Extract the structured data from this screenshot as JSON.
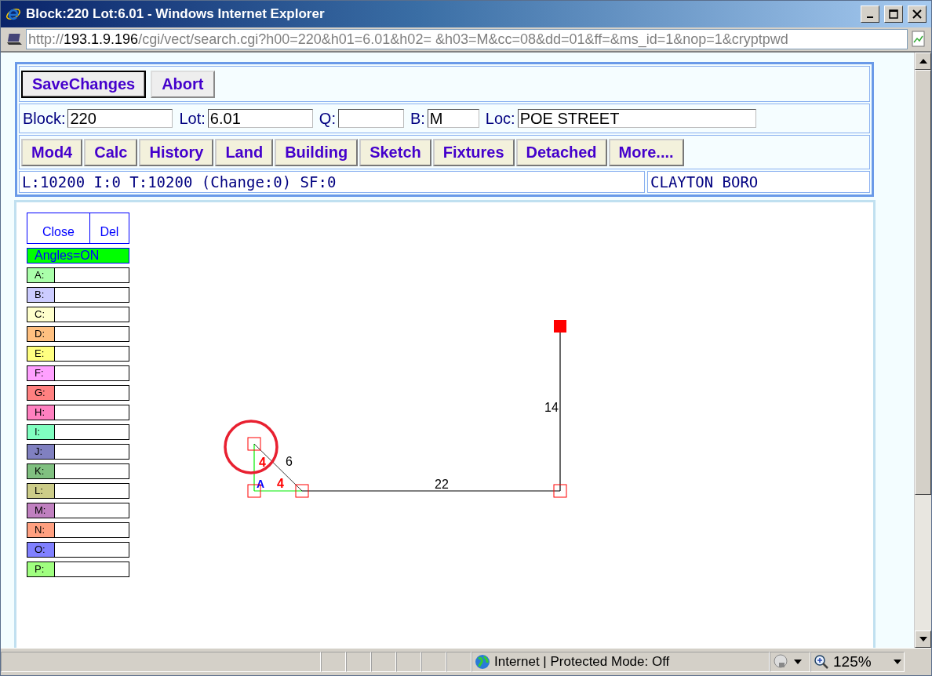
{
  "window": {
    "title": "Block:220 Lot:6.01 - Windows Internet Explorer"
  },
  "address": {
    "scheme": "http://",
    "host": "193.1.9.196",
    "path": "/cgi/vect/search.cgi?h00=220&h01=6.01&h02= &h03=M&cc=08&dd=01&ff=&ms_id=1&nop=1&cryptpwd"
  },
  "actions": [
    {
      "label": "SaveChanges",
      "selected": true
    },
    {
      "label": "Abort",
      "selected": false
    }
  ],
  "fields": [
    {
      "label": "Block:",
      "value": "220"
    },
    {
      "label": "Lot:",
      "value": "6.01"
    },
    {
      "label": "Q:"
    },
    {
      "label": "B:",
      "value": "M"
    },
    {
      "label": "Loc:",
      "value": "POE STREET"
    }
  ],
  "nav": [
    "Mod4",
    "Calc",
    "History",
    "Land",
    "Building",
    "Sketch",
    "Fixtures",
    "Detached",
    "More...."
  ],
  "summary": {
    "values": "L:10200 I:0 T:10200 (Change:0) SF:0",
    "town": "CLAYTON BORO"
  },
  "palette": {
    "buttons": [
      "Close",
      "Del"
    ],
    "angles": {
      "label": "Angles=ON",
      "on": true
    },
    "areas": [
      {
        "label": "A:",
        "color": "#aaffaa"
      },
      {
        "label": "B:",
        "color": "#ccccff"
      },
      {
        "label": "C:",
        "color": "#ffffcc"
      },
      {
        "label": "D:",
        "color": "#ffc080"
      },
      {
        "label": "E:",
        "color": "#ffff80"
      },
      {
        "label": "F:",
        "color": "#ffa0ff"
      },
      {
        "label": "G:",
        "color": "#ff8080"
      },
      {
        "label": "H:",
        "color": "#ff80c0"
      },
      {
        "label": "I:",
        "color": "#80ffc0"
      },
      {
        "label": "J:",
        "color": "#8080c0"
      },
      {
        "label": "K:",
        "color": "#80c080"
      },
      {
        "label": "L:",
        "color": "#cccc88"
      },
      {
        "label": "M:",
        "color": "#c080c0"
      },
      {
        "label": "N:",
        "color": "#ffa080"
      },
      {
        "label": "O:",
        "color": "#8080ff"
      },
      {
        "label": "P:",
        "color": "#a0ff80"
      }
    ]
  },
  "sketch": {
    "area_label": "A",
    "segments": [
      {
        "label": "4",
        "kind": "area"
      },
      {
        "label": "4",
        "kind": "area"
      },
      {
        "label": "6",
        "kind": "diagonal"
      },
      {
        "label": "22",
        "kind": "line"
      },
      {
        "label": "14",
        "kind": "line"
      }
    ]
  },
  "status_bar": {
    "zone": "Internet | Protected Mode: Off",
    "zoom": "125%"
  }
}
